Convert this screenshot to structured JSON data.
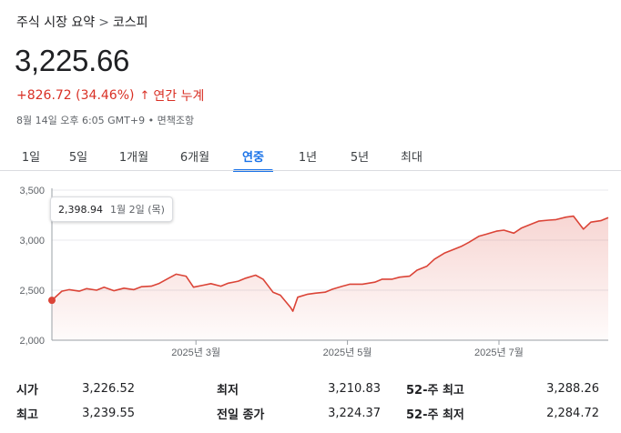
{
  "breadcrumb": {
    "parent": "주식 시장 요약",
    "separator": ">",
    "current": "코스피"
  },
  "price": "3,225.66",
  "change": {
    "text": "+826.72 (34.46%)",
    "arrow": "↑",
    "period": "연간 누계",
    "color": "#d93025"
  },
  "meta": "8월 14일 오후 6:05 GMT+9 • 면책조항",
  "tabs": [
    {
      "label": "1일",
      "active": false
    },
    {
      "label": "5일",
      "active": false
    },
    {
      "label": "1개월",
      "active": false
    },
    {
      "label": "6개월",
      "active": false
    },
    {
      "label": "연중",
      "active": true
    },
    {
      "label": "1년",
      "active": false
    },
    {
      "label": "5년",
      "active": false
    },
    {
      "label": "최대",
      "active": false
    }
  ],
  "tooltip": {
    "value": "2,398.94",
    "date": "1월 2일 (목)"
  },
  "chart_data": {
    "type": "area",
    "ylim": [
      2000,
      3500
    ],
    "yticks": [
      2000,
      2500,
      3000,
      3500
    ],
    "ytick_labels": [
      "2,000",
      "2,500",
      "3,000",
      "3,500"
    ],
    "xlim": [
      "2025-01-02",
      "2025-08-14"
    ],
    "xticks": [
      "2025-03-01",
      "2025-05-01",
      "2025-07-01"
    ],
    "xtick_labels": [
      "2025년 3월",
      "2025년 5월",
      "2025년 7월"
    ],
    "grid": true,
    "color": "#db4437",
    "highlight": {
      "x": "2025-01-02",
      "y": 2398.94
    },
    "x": [
      "2025-01-02",
      "2025-01-06",
      "2025-01-09",
      "2025-01-13",
      "2025-01-16",
      "2025-01-20",
      "2025-01-23",
      "2025-01-27",
      "2025-01-31",
      "2025-02-04",
      "2025-02-07",
      "2025-02-11",
      "2025-02-14",
      "2025-02-18",
      "2025-02-21",
      "2025-02-25",
      "2025-02-28",
      "2025-03-04",
      "2025-03-07",
      "2025-03-11",
      "2025-03-14",
      "2025-03-18",
      "2025-03-21",
      "2025-03-25",
      "2025-03-28",
      "2025-04-01",
      "2025-04-04",
      "2025-04-08",
      "2025-04-09",
      "2025-04-11",
      "2025-04-15",
      "2025-04-18",
      "2025-04-22",
      "2025-04-25",
      "2025-04-29",
      "2025-05-02",
      "2025-05-07",
      "2025-05-12",
      "2025-05-15",
      "2025-05-19",
      "2025-05-22",
      "2025-05-26",
      "2025-05-29",
      "2025-06-02",
      "2025-06-05",
      "2025-06-09",
      "2025-06-12",
      "2025-06-16",
      "2025-06-19",
      "2025-06-23",
      "2025-06-26",
      "2025-06-30",
      "2025-07-03",
      "2025-07-07",
      "2025-07-10",
      "2025-07-14",
      "2025-07-17",
      "2025-07-21",
      "2025-07-24",
      "2025-07-28",
      "2025-07-31",
      "2025-08-04",
      "2025-08-07",
      "2025-08-11",
      "2025-08-14"
    ],
    "values": [
      2398.94,
      2490,
      2505,
      2490,
      2515,
      2500,
      2530,
      2495,
      2520,
      2505,
      2535,
      2540,
      2565,
      2620,
      2660,
      2640,
      2530,
      2550,
      2565,
      2540,
      2570,
      2590,
      2620,
      2650,
      2610,
      2480,
      2450,
      2330,
      2290,
      2430,
      2460,
      2470,
      2480,
      2510,
      2540,
      2560,
      2560,
      2580,
      2610,
      2610,
      2630,
      2640,
      2700,
      2740,
      2810,
      2870,
      2900,
      2940,
      2980,
      3040,
      3060,
      3090,
      3100,
      3070,
      3120,
      3160,
      3190,
      3200,
      3205,
      3230,
      3240,
      3110,
      3180,
      3195,
      3225.66
    ]
  },
  "stats": {
    "rows": [
      [
        {
          "label": "시가",
          "value": "3,226.52"
        },
        {
          "label": "최저",
          "value": "3,210.83"
        },
        {
          "label": "52-주 최고",
          "value": "3,288.26"
        }
      ],
      [
        {
          "label": "최고",
          "value": "3,239.55"
        },
        {
          "label": "전일 종가",
          "value": "3,224.37"
        },
        {
          "label": "52-주 최저",
          "value": "2,284.72"
        }
      ]
    ]
  }
}
